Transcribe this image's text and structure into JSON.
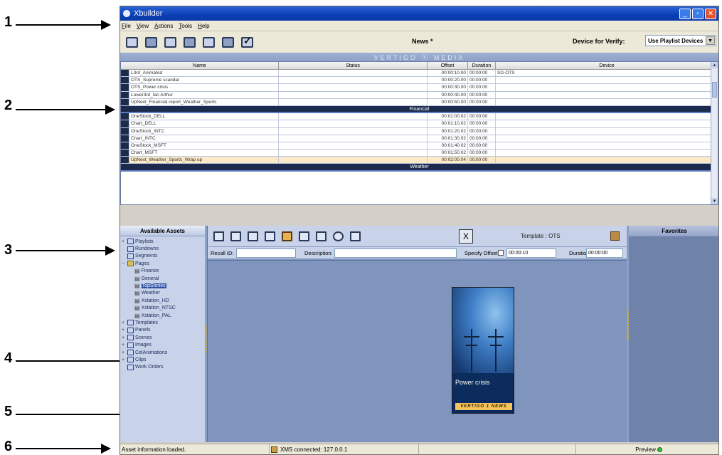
{
  "callouts": [
    "1",
    "2",
    "3",
    "4",
    "5",
    "6"
  ],
  "window": {
    "title": "Xbuilder"
  },
  "menu": [
    "File",
    "View",
    "Actions",
    "Tools",
    "Help"
  ],
  "toolbar": {
    "doc_title": "News *",
    "device_label": "Device for Verify:",
    "device_value": "Use Playlist Devices"
  },
  "brand": "VERTIGO ⓧ MEDIA",
  "grid": {
    "columns": [
      "Name",
      "Status",
      "Offset",
      "Duration",
      "Device"
    ],
    "rows_top": [
      {
        "name": "L3rd_Animated",
        "offset": "00:00:10.00",
        "duration": "00:00:00",
        "device": "SD-OTS"
      },
      {
        "name": "OTS_Supreme scandal",
        "offset": "00:00:20.00",
        "duration": "00:00:00",
        "device": ""
      },
      {
        "name": "OTS_Power crisis",
        "offset": "00:00:30.00",
        "duration": "00:00:00",
        "device": ""
      },
      {
        "name": "Lower3rd_Ian Arthur",
        "offset": "00:00:40.00",
        "duration": "00:00:00",
        "device": ""
      },
      {
        "name": "UpNext_Financial report_Weather_Sports",
        "offset": "00:00:50.00",
        "duration": "00:00:00",
        "device": ""
      }
    ],
    "group_financial": "Financial",
    "rows_financial": [
      {
        "name": "OneStock_DELL",
        "offset": "00:01:00.02",
        "duration": "00:00:00",
        "device": ""
      },
      {
        "name": "Chart_DELL",
        "offset": "00:01:10.02",
        "duration": "00:00:00",
        "device": ""
      },
      {
        "name": "OneStock_INTC",
        "offset": "00:01:20.02",
        "duration": "00:00:00",
        "device": ""
      },
      {
        "name": "Chart_INTC",
        "offset": "00:01:30.02",
        "duration": "00:00:00",
        "device": ""
      },
      {
        "name": "OneStock_MSFT",
        "offset": "00:01:40.02",
        "duration": "00:00:00",
        "device": ""
      },
      {
        "name": "Chart_MSFT",
        "offset": "00:01:50.02",
        "duration": "00:00:00",
        "device": ""
      },
      {
        "name": "UpNext_Weather_Sports_Wrap up",
        "offset": "00:02:00.04",
        "duration": "00:00:00",
        "device": ""
      }
    ],
    "group_weather": "Weather"
  },
  "assets": {
    "title": "Available Assets",
    "items": [
      {
        "label": "Playlists",
        "exp": "+"
      },
      {
        "label": "Rundowns",
        "exp": ""
      },
      {
        "label": "Segments",
        "exp": ""
      },
      {
        "label": "Pages",
        "exp": "−"
      },
      {
        "label": "Finance",
        "child": true
      },
      {
        "label": "General",
        "child": true
      },
      {
        "label": "TopStories",
        "child": true,
        "selected": true
      },
      {
        "label": "Weather",
        "child": true
      },
      {
        "label": "Xstation_HD",
        "child": true
      },
      {
        "label": "Xstation_NTSC",
        "child": true
      },
      {
        "label": "Xstation_PAL",
        "child": true
      },
      {
        "label": "Templates",
        "exp": "+"
      },
      {
        "label": "Panels",
        "exp": "+"
      },
      {
        "label": "Scenes",
        "exp": "+"
      },
      {
        "label": "Images",
        "exp": "+"
      },
      {
        "label": "CelAnimations",
        "exp": "+"
      },
      {
        "label": "Clips",
        "exp": "+"
      },
      {
        "label": "Work Orders",
        "exp": ""
      }
    ]
  },
  "editor": {
    "close_label": "X",
    "template_label": "Template : OTS",
    "recall_label": "Recall ID:",
    "recall_value": "",
    "description_label": "Description:",
    "description_value": "",
    "specify_offset_label": "Specify Offset:",
    "offset_value": "00:00:10",
    "duration_label": "Duration:",
    "duration_value": "00:00:00",
    "preview_title": "Power crisis",
    "preview_footer": "VERTIGO 1 NEWS"
  },
  "favorites": {
    "title": "Favorites"
  },
  "status": {
    "message": "Asset information loaded.",
    "connection": "XMS connected: 127.0.0.1",
    "preview": "Preview"
  }
}
